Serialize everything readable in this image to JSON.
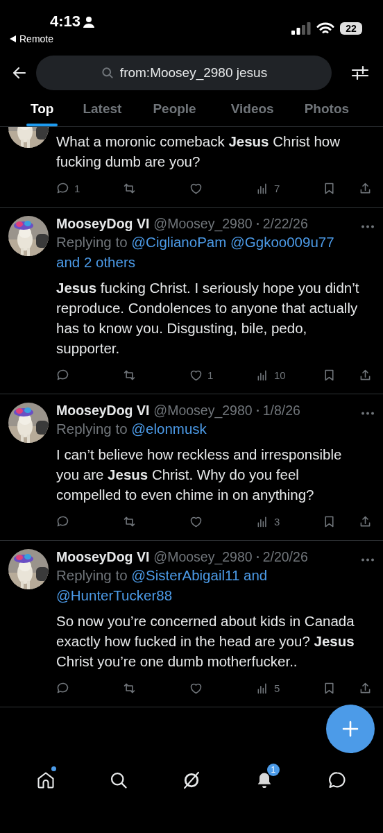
{
  "status_bar": {
    "time": "4:13",
    "back_app": "Remote",
    "battery": "22"
  },
  "search": {
    "value": "from:Moosey_2980 jesus"
  },
  "tabs": [
    {
      "label": "Top",
      "selected": true
    },
    {
      "label": "Latest",
      "selected": false
    },
    {
      "label": "People",
      "selected": false
    },
    {
      "label": "Videos",
      "selected": false
    },
    {
      "label": "Photos",
      "selected": false
    }
  ],
  "posts": [
    {
      "kind": "clipped",
      "text": "What a moronic comeback **Jesus** Christ how fucking dumb are you?",
      "replies": "1",
      "views": "7"
    },
    {
      "kind": "full",
      "name": "MooseyDog VI",
      "handle": "@Moosey_2980",
      "date": "2/22/26",
      "reply_prefix": "Replying to",
      "reply_mentions": "@CiglianoPam @Ggkoo009u77 and 2 others",
      "text": "**Jesus** fucking Christ. I seriously hope you didn’t reproduce. Condolences to anyone that actually has to know you. Disgusting, bile, pedo, supporter.",
      "likes": "1",
      "views": "10"
    },
    {
      "kind": "full",
      "name": "MooseyDog VI",
      "handle": "@Moosey_2980",
      "date": "1/8/26",
      "reply_prefix": "Replying to",
      "reply_mentions": "@elonmusk",
      "text": "I can’t believe how reckless and irresponsible you are **Jesus** Christ. Why do you feel compelled to even chime in on anything?",
      "views": "3"
    },
    {
      "kind": "full",
      "name": "MooseyDog VI",
      "handle": "@Moosey_2980",
      "date": "2/20/26",
      "reply_prefix": "Replying to",
      "reply_mentions": "@SisterAbigail11 and @HunterTucker88",
      "text": "So now you’re concerned about kids in Canada exactly how fucked in the head are you? **Jesus** Christ you’re one dumb motherfucker..",
      "views": "5"
    }
  ],
  "nav": {
    "home_dot": true,
    "notifications_badge": "1"
  }
}
